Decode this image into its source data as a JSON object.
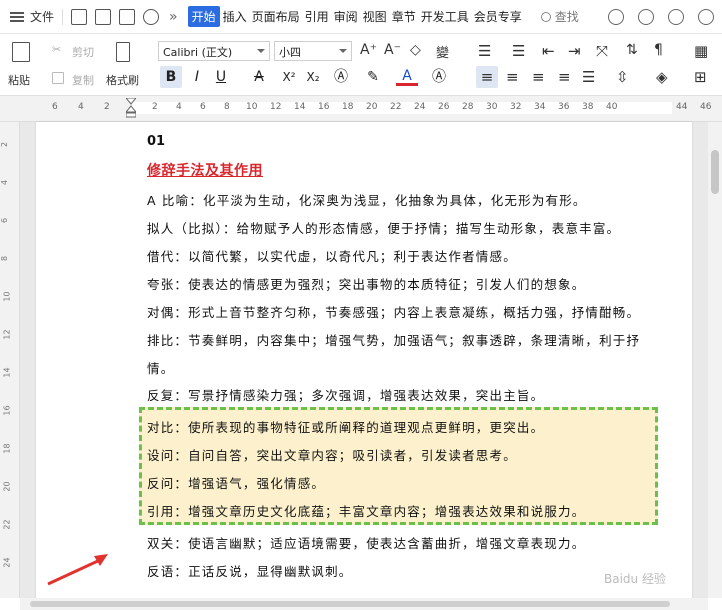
{
  "menu": {
    "file_label": "文件",
    "more_label": "»",
    "tabs": [
      "开始",
      "插入",
      "页面布局",
      "引用",
      "审阅",
      "视图",
      "章节",
      "开发工具",
      "会员专享"
    ],
    "search_label": "查找"
  },
  "ribbon": {
    "paste_label": "粘贴",
    "cut_label": "剪切",
    "copy_label": "复制",
    "format_painter_label": "格式刷",
    "font_name": "Calibri (正文)",
    "font_size": "小四",
    "bold": "B",
    "italic": "I",
    "underline": "U",
    "strike": "A",
    "superscript": "X²",
    "subscript": "X₂",
    "font_color": "A"
  },
  "ruler": {
    "numbers": [
      "6",
      "4",
      "2",
      "2",
      "4",
      "6",
      "8",
      "10",
      "12",
      "14",
      "16",
      "18",
      "20",
      "22",
      "24",
      "26",
      "28",
      "30",
      "32",
      "34",
      "36",
      "38",
      "40",
      "44",
      "46"
    ]
  },
  "vruler": {
    "numbers": [
      "2",
      "4",
      "6",
      "8",
      "10",
      "12",
      "14",
      "16",
      "18",
      "20",
      "22",
      "24"
    ]
  },
  "document": {
    "number": "01",
    "heading": "修辞手法及其作用",
    "lines": [
      "A 比喻：化平淡为生动，化深奥为浅显，化抽象为具体，化无形为有形。",
      "拟人（比拟）：给物赋予人的形态情感，便于抒情；描写生动形象，表意丰富。",
      "借代：以简代繁，以实代虚，以奇代凡；利于表达作者情感。",
      "夸张：使表达的情感更为强烈；突出事物的本质特征；引发人们的想象。",
      "对偶：形式上音节整齐匀称，节奏感强；内容上表意凝练，概括力强，抒情酣畅。",
      "排比：节奏鲜明，内容集中；增强气势，加强语气；叙事透辟，条理清晰，利于抒",
      "情。",
      "反复：写景抒情感染力强；多次强调，增强表达效果，突出主旨。"
    ],
    "highlighted_lines": [
      "对比：使所表现的事物特征或所阐释的道理观点更鲜明，更突出。",
      "设问：自问自答，突出文章内容；吸引读者，引发读者思考。",
      "反问：增强语气，强化情感。",
      "引用：增强文章历史文化底蕴；丰富文章内容；增强表达效果和说服力。"
    ],
    "after_lines": [
      "双关：使语言幽默；适应语境需要，使表达含蓄曲折，增强文章表现力。",
      "反语：正话反说，显得幽默讽刺。"
    ]
  },
  "colors": {
    "accent_tab": "#2b6ce0",
    "heading_red": "#d9262c",
    "highlight_fill": "#fcf1cc",
    "highlight_border": "#6cbf4a",
    "arrow_red": "#e0332f"
  },
  "watermark": "Baidu 经验"
}
